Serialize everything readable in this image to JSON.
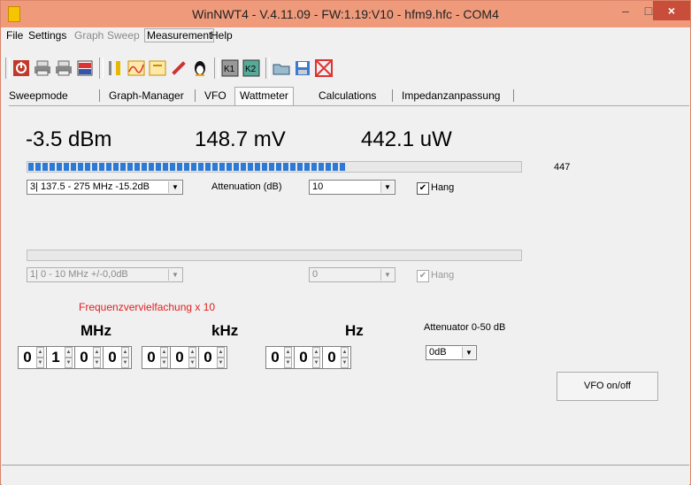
{
  "window": {
    "title": "WinNWT4 - V.4.11.09 - FW:1.19:V10 - hfm9.hfc - COM4",
    "min": "–",
    "max": "□",
    "close": "×"
  },
  "menu": {
    "file": "File",
    "settings": "Settings",
    "graph": "Graph",
    "sweep": "Sweep",
    "measurement": "Measurement",
    "help": "Help"
  },
  "tabs": {
    "sweepmode": "Sweepmode",
    "graph_manager": "Graph-Manager",
    "vfo": "VFO",
    "wattmeter": "Wattmeter",
    "calculations": "Calculations",
    "impedanz": "Impedanzanpassung"
  },
  "readout": {
    "dbm": "-3.5 dBm",
    "mv": "148.7 mV",
    "uw": "442.1 uW"
  },
  "channel1": {
    "level": 0.65,
    "value": "447",
    "range": "3| 137.5 - 275 MHz -15.2dB",
    "attenuation_label": "Attenuation (dB)",
    "attenuation": "10",
    "hang_label": "Hang",
    "hang_checked": true
  },
  "channel2": {
    "level": 0.0,
    "range": "1| 0 - 10 MHz +/-0,0dB",
    "attenuation": "0",
    "hang_label": "Hang",
    "hang_checked": true
  },
  "vfo": {
    "multiplier": "Frequenzvervielfachung x 10",
    "mhz": "MHz",
    "khz": "kHz",
    "hz": "Hz",
    "digits": [
      "0",
      "1",
      "0",
      "0",
      "0",
      "0",
      "0",
      "0",
      "0",
      "0"
    ],
    "attenuator_label": "Attenuator 0-50 dB",
    "attenuator_value": "0dB",
    "onoff": "VFO on/off"
  },
  "icons": {
    "check": "✔",
    "arrow": "▼",
    "up": "▲",
    "down": "▼"
  }
}
